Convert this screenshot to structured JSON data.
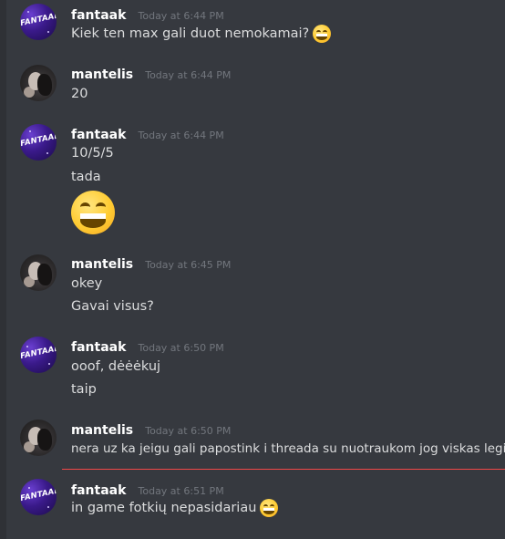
{
  "messages": [
    {
      "user": "fantaak",
      "timestamp": "Today at 6:44 PM",
      "lines": [
        {
          "text": "Kiek ten max gali duot nemokamai?",
          "emoji": "grinning-face-with-smiling-eyes"
        }
      ]
    },
    {
      "user": "mantelis",
      "timestamp": "Today at 6:44 PM",
      "lines": [
        {
          "text": "20"
        }
      ]
    },
    {
      "user": "fantaak",
      "timestamp": "Today at 6:44 PM",
      "lines": [
        {
          "text": "10/5/5"
        },
        {
          "text": "tada"
        },
        {
          "big_emoji": "grinning-face-with-smiling-eyes"
        }
      ]
    },
    {
      "user": "mantelis",
      "timestamp": "Today at 6:45 PM",
      "lines": [
        {
          "text": "okey"
        },
        {
          "text": "Gavai visus?"
        }
      ]
    },
    {
      "user": "fantaak",
      "timestamp": "Today at 6:50 PM",
      "lines": [
        {
          "text": "ooof, dėėėkuj"
        },
        {
          "text": "taip"
        }
      ]
    },
    {
      "user": "mantelis",
      "timestamp": "Today at 6:50 PM",
      "lines": [
        {
          "text": "nera uz ka jeigu gali papostink i threada su nuotraukom jog viskas legit"
        }
      ]
    },
    {
      "user": "fantaak",
      "timestamp": "Today at 6:51 PM",
      "lines": [
        {
          "text": "in game fotkių nepasidariau",
          "emoji": "grinning-face-with-smiling-eyes"
        }
      ]
    }
  ],
  "avatar_text": "FANTAAK",
  "colors": {
    "background": "#36393f",
    "username": "#ffffff",
    "timestamp": "#72767d",
    "message_text": "#dcddde",
    "new_messages_divider": "#f04747"
  }
}
